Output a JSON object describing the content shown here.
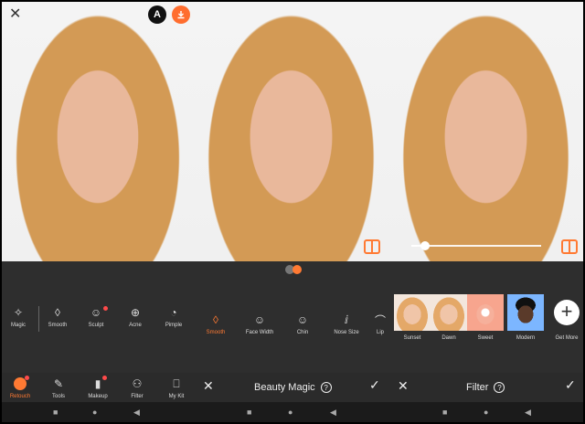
{
  "app": {
    "accent": "#ff7a33",
    "badge_a": "A"
  },
  "top": {
    "close_icon": "close-icon",
    "download_icon": "download-icon"
  },
  "slider": {
    "value_fraction": 0.08
  },
  "tools_retouch": [
    {
      "label": "Magic",
      "icon": "✧"
    },
    {
      "label": "Smooth",
      "icon": "◊"
    },
    {
      "label": "Sculpt",
      "icon": "☺"
    },
    {
      "label": "Acne",
      "icon": "⊕"
    },
    {
      "label": "Pimple",
      "icon": "◔"
    }
  ],
  "tools_beauty": [
    {
      "label": "Smooth",
      "icon": "◊"
    },
    {
      "label": "Face Width",
      "icon": "☺"
    },
    {
      "label": "Chin",
      "icon": "☺"
    },
    {
      "label": "Nose Size",
      "icon": "ⅈ"
    },
    {
      "label": "Lip",
      "icon": "⌒"
    }
  ],
  "filters": [
    {
      "label": "Sunset"
    },
    {
      "label": "Dawn"
    },
    {
      "label": "Sweet"
    },
    {
      "label": "Modern"
    }
  ],
  "get_more": "Get More",
  "bottom_nav": [
    {
      "label": "Retouch"
    },
    {
      "label": "Tools"
    },
    {
      "label": "Makeup"
    },
    {
      "label": "Filter"
    },
    {
      "label": "My Kit"
    }
  ],
  "beauty_bar": {
    "title": "Beauty Magic",
    "help": "?"
  },
  "filter_bar": {
    "title": "Filter",
    "help": "?"
  },
  "system": {
    "home": "●",
    "back": "◀",
    "recent": "■"
  }
}
